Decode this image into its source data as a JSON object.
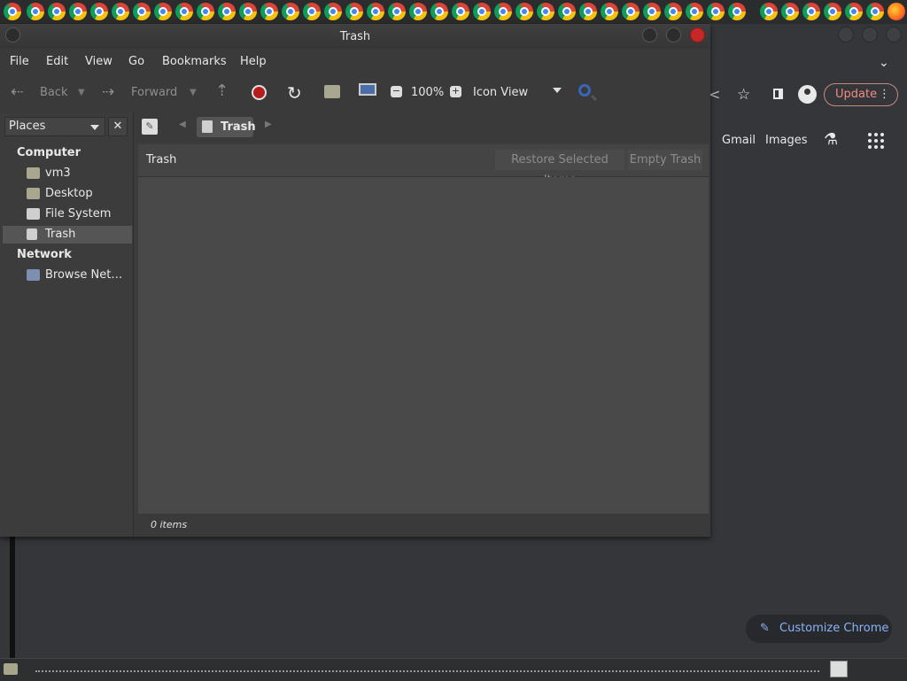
{
  "taskbar_top": {
    "icons": "chrome-icons"
  },
  "chrome": {
    "update_label": "Update",
    "links": {
      "gmail": "Gmail",
      "images": "Images"
    },
    "customize_label": "Customize Chrome"
  },
  "window": {
    "title": "Trash",
    "menu": [
      "File",
      "Edit",
      "View",
      "Go",
      "Bookmarks",
      "Help"
    ],
    "toolbar": {
      "back": "Back",
      "forward": "Forward",
      "zoom": "100%",
      "view_mode": "Icon View"
    },
    "sidebar": {
      "selector": "Places",
      "sections": {
        "computer": "Computer",
        "network": "Network"
      },
      "items": [
        "vm3",
        "Desktop",
        "File System",
        "Trash",
        "Browse Net…"
      ]
    },
    "pathbar": {
      "crumb": "Trash"
    },
    "infobar": {
      "title": "Trash",
      "restore": "Restore Selected Items",
      "empty": "Empty Trash"
    },
    "status": "0 items"
  },
  "colors": {
    "accent_update": "#f28b82",
    "accent_link": "#8ab4f8",
    "close_button": "#c62828",
    "selection": "#555555"
  }
}
